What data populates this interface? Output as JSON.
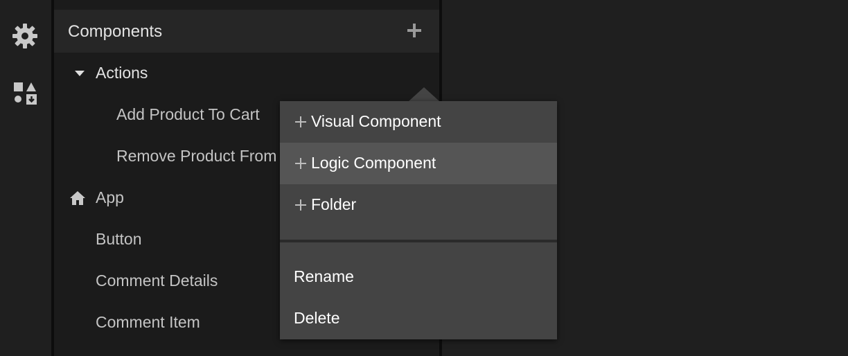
{
  "panel": {
    "title": "Components",
    "tree": [
      {
        "label": "Actions"
      },
      {
        "label": "Add Product To Cart"
      },
      {
        "label": "Remove Product From Cart"
      },
      {
        "label": "App"
      },
      {
        "label": "Button"
      },
      {
        "label": "Comment Details"
      },
      {
        "label": "Comment Item"
      }
    ]
  },
  "context_menu": {
    "items": [
      {
        "label": "Visual Component"
      },
      {
        "label": "Logic Component"
      },
      {
        "label": "Folder"
      },
      {
        "label": "Rename"
      },
      {
        "label": "Delete"
      }
    ]
  },
  "icons": {
    "settings": "gear-icon",
    "components": "shapes-icon",
    "app": "home-icon"
  }
}
